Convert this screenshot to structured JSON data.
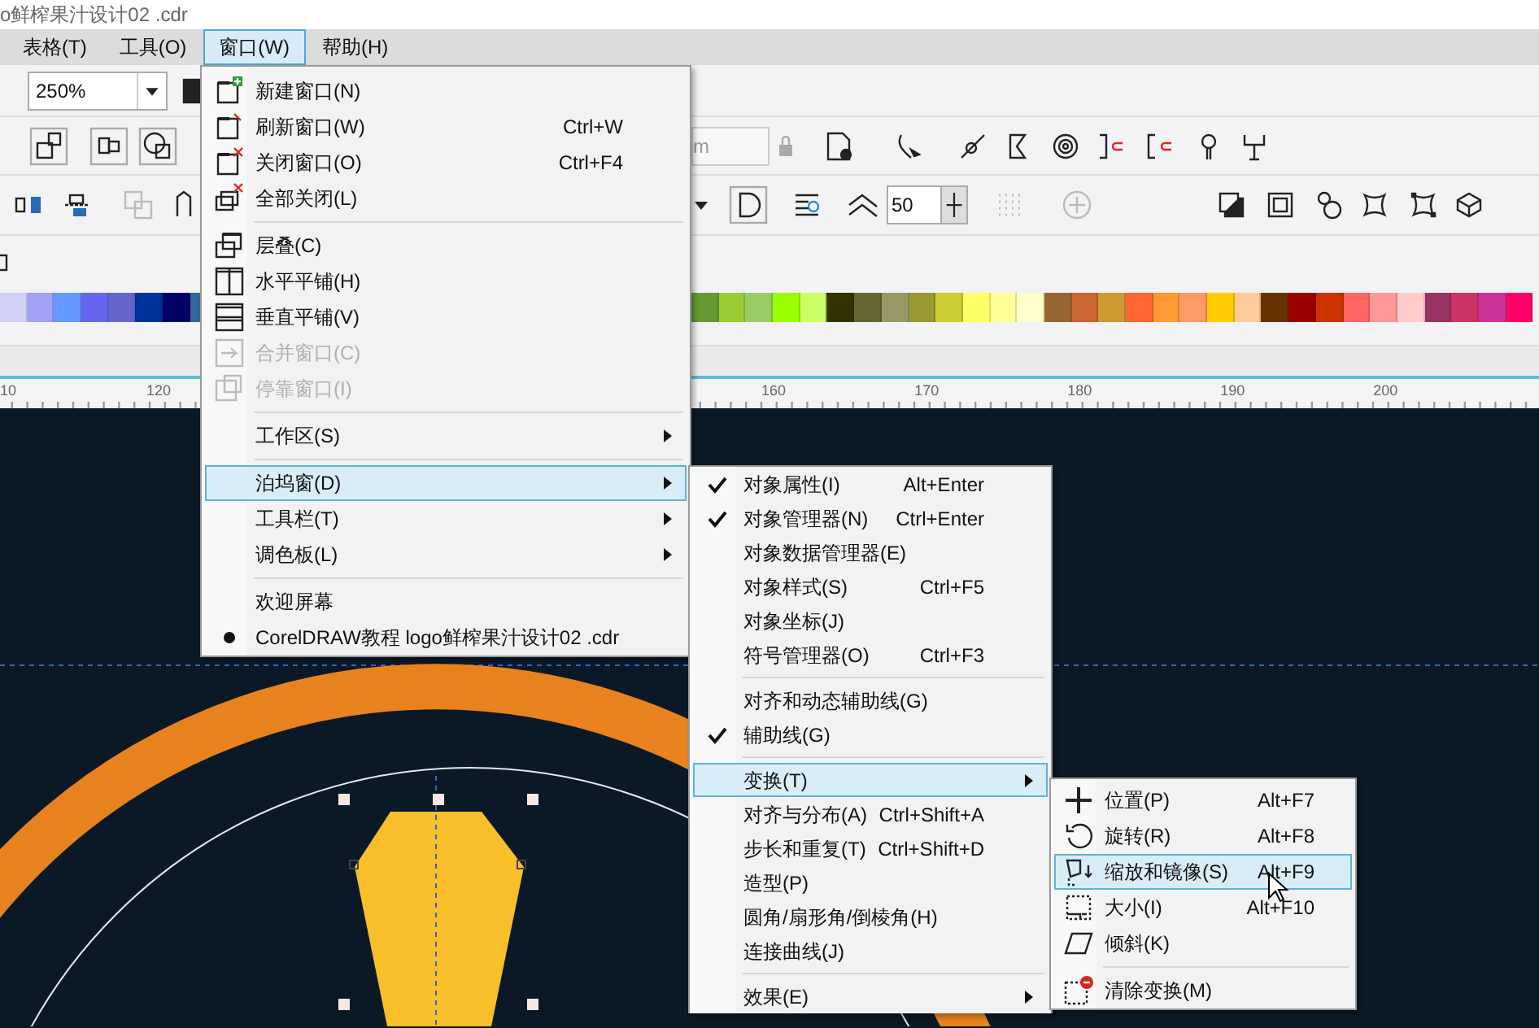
{
  "title_bar": {
    "title": "o鲜榨果汁设计02 .cdr"
  },
  "menu_bar": [
    {
      "label": "表格(T)",
      "selected": false
    },
    {
      "label": "工具(O)",
      "selected": false
    },
    {
      "label": "窗口(W)",
      "selected": true
    },
    {
      "label": "帮助(H)",
      "selected": false
    }
  ],
  "toolbar": {
    "zoom": "250%",
    "outline_width": "m",
    "smoothing": "50"
  },
  "palette": {
    "left": [
      {
        "color": "#d0d0f8"
      },
      {
        "color": "#a0a0f4"
      },
      {
        "color": "#6699ff"
      },
      {
        "color": "#6666ee"
      },
      {
        "color": "#6666cc"
      },
      {
        "color": "#003399"
      },
      {
        "color": "#000066"
      },
      {
        "color": "#336699"
      }
    ],
    "right": [
      {
        "color": "#669933"
      },
      {
        "color": "#99cc33"
      },
      {
        "color": "#99cc66"
      },
      {
        "color": "#99ff00"
      },
      {
        "color": "#ccff66"
      },
      {
        "color": "#333300"
      },
      {
        "color": "#666633"
      },
      {
        "color": "#999966"
      },
      {
        "color": "#999933"
      },
      {
        "color": "#cccc33"
      },
      {
        "color": "#ffff66"
      },
      {
        "color": "#ffff99"
      },
      {
        "color": "#ffffcc"
      },
      {
        "color": "#996633"
      },
      {
        "color": "#cc6633"
      },
      {
        "color": "#cc9933"
      },
      {
        "color": "#ff6633"
      },
      {
        "color": "#ff9933"
      },
      {
        "color": "#ff9966"
      },
      {
        "color": "#ffcc00"
      },
      {
        "color": "#ffcc99"
      },
      {
        "color": "#663300"
      },
      {
        "color": "#990000"
      },
      {
        "color": "#cc3300"
      },
      {
        "color": "#ff6666"
      },
      {
        "color": "#ff9999"
      },
      {
        "color": "#ffcccc"
      },
      {
        "color": "#993366"
      },
      {
        "color": "#cc3366"
      },
      {
        "color": "#cc3399"
      },
      {
        "color": "#ff0066"
      }
    ]
  },
  "ruler": {
    "labels": [
      "10",
      "120",
      "160",
      "170",
      "180",
      "190",
      "200"
    ]
  },
  "window_menu": [
    {
      "kind": "item",
      "label": "新建窗口(N)",
      "disabled": false,
      "selected": false,
      "submenu": false,
      "checked": false
    },
    {
      "kind": "item",
      "label": "刷新窗口(W)",
      "shortcut": "Ctrl+W",
      "disabled": false,
      "selected": false,
      "submenu": false,
      "checked": false
    },
    {
      "kind": "item",
      "label": "关闭窗口(O)",
      "shortcut": "Ctrl+F4",
      "disabled": false,
      "selected": false,
      "submenu": false,
      "checked": false
    },
    {
      "kind": "item",
      "label": "全部关闭(L)",
      "disabled": false,
      "selected": false,
      "submenu": false,
      "checked": false
    },
    {
      "kind": "separator"
    },
    {
      "kind": "item",
      "label": "层叠(C)",
      "disabled": false,
      "selected": false,
      "submenu": false,
      "checked": false
    },
    {
      "kind": "item",
      "label": "水平平铺(H)",
      "disabled": false,
      "selected": false,
      "submenu": false,
      "checked": false
    },
    {
      "kind": "item",
      "label": "垂直平铺(V)",
      "disabled": false,
      "selected": false,
      "submenu": false,
      "checked": false
    },
    {
      "kind": "item",
      "label": "合并窗口(C)",
      "disabled": true,
      "selected": false,
      "submenu": false,
      "checked": false
    },
    {
      "kind": "item",
      "label": "停靠窗口(I)",
      "disabled": true,
      "selected": false,
      "submenu": false,
      "checked": false
    },
    {
      "kind": "separator"
    },
    {
      "kind": "item",
      "label": "工作区(S)",
      "disabled": false,
      "selected": false,
      "submenu": true,
      "checked": false
    },
    {
      "kind": "separator"
    },
    {
      "kind": "item",
      "label": "泊坞窗(D)",
      "disabled": false,
      "selected": true,
      "submenu": true,
      "checked": false
    },
    {
      "kind": "item",
      "label": "工具栏(T)",
      "disabled": false,
      "selected": false,
      "submenu": true,
      "checked": false
    },
    {
      "kind": "item",
      "label": "调色板(L)",
      "disabled": false,
      "selected": false,
      "submenu": true,
      "checked": false
    },
    {
      "kind": "separator"
    },
    {
      "kind": "item",
      "label": "欢迎屏幕",
      "disabled": false,
      "selected": false,
      "submenu": false,
      "checked": false
    },
    {
      "kind": "item",
      "label": "CorelDRAW教程 logo鲜榨果汁设计02 .cdr",
      "disabled": false,
      "selected": false,
      "submenu": false,
      "checked": true
    }
  ],
  "docker_menu": [
    {
      "kind": "item",
      "label": "对象属性(I)",
      "shortcut": "Alt+Enter",
      "checked": true,
      "selected": false,
      "submenu": false
    },
    {
      "kind": "item",
      "label": "对象管理器(N)",
      "shortcut": "Ctrl+Enter",
      "checked": true,
      "selected": false,
      "submenu": false
    },
    {
      "kind": "item",
      "label": "对象数据管理器(E)",
      "checked": false,
      "selected": false,
      "submenu": false
    },
    {
      "kind": "item",
      "label": "对象样式(S)",
      "shortcut": "Ctrl+F5",
      "checked": false,
      "selected": false,
      "submenu": false
    },
    {
      "kind": "item",
      "label": "对象坐标(J)",
      "checked": false,
      "selected": false,
      "submenu": false
    },
    {
      "kind": "item",
      "label": "符号管理器(O)",
      "shortcut": "Ctrl+F3",
      "checked": false,
      "selected": false,
      "submenu": false
    },
    {
      "kind": "separator"
    },
    {
      "kind": "item",
      "label": "对齐和动态辅助线(G)",
      "checked": false,
      "selected": false,
      "submenu": false
    },
    {
      "kind": "item",
      "label": "辅助线(G)",
      "checked": true,
      "selected": false,
      "submenu": false
    },
    {
      "kind": "separator"
    },
    {
      "kind": "item",
      "label": "变换(T)",
      "checked": false,
      "selected": true,
      "submenu": true
    },
    {
      "kind": "item",
      "label": "对齐与分布(A)",
      "shortcut": "Ctrl+Shift+A",
      "checked": false,
      "selected": false,
      "submenu": false
    },
    {
      "kind": "item",
      "label": "步长和重复(T)",
      "shortcut": "Ctrl+Shift+D",
      "checked": false,
      "selected": false,
      "submenu": false
    },
    {
      "kind": "item",
      "label": "造型(P)",
      "checked": false,
      "selected": false,
      "submenu": false
    },
    {
      "kind": "item",
      "label": "圆角/扇形角/倒棱角(H)",
      "checked": false,
      "selected": false,
      "submenu": false
    },
    {
      "kind": "item",
      "label": "连接曲线(J)",
      "checked": false,
      "selected": false,
      "submenu": false
    },
    {
      "kind": "separator"
    },
    {
      "kind": "item",
      "label": "效果(E)",
      "checked": false,
      "selected": false,
      "submenu": true
    }
  ],
  "transform_menu": [
    {
      "kind": "item",
      "label": "位置(P)",
      "shortcut": "Alt+F7",
      "selected": false
    },
    {
      "kind": "item",
      "label": "旋转(R)",
      "shortcut": "Alt+F8",
      "selected": false
    },
    {
      "kind": "item",
      "label": "缩放和镜像(S)",
      "shortcut": "Alt+F9",
      "selected": true
    },
    {
      "kind": "item",
      "label": "大小(I)",
      "shortcut": "Alt+F10",
      "selected": false
    },
    {
      "kind": "item",
      "label": "倾斜(K)",
      "selected": false
    },
    {
      "kind": "separator"
    },
    {
      "kind": "item",
      "label": "清除变换(M)",
      "selected": false
    }
  ]
}
